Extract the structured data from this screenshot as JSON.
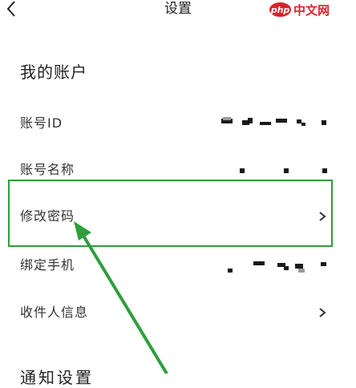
{
  "header": {
    "title": "设置",
    "watermark_badge": "php",
    "watermark_text": "中文网"
  },
  "account": {
    "section_title": "我的账户",
    "rows": [
      {
        "label": "账号ID"
      },
      {
        "label": "账号名称"
      },
      {
        "label": "修改密码"
      },
      {
        "label": "绑定手机"
      },
      {
        "label": "收件人信息"
      }
    ]
  },
  "next_section_title": "通知设置",
  "icons": {
    "back": "chevron-left-icon",
    "row_arrow": "chevron-right-icon"
  },
  "colors": {
    "highlight": "#2e9e3b",
    "text": "#222222"
  }
}
